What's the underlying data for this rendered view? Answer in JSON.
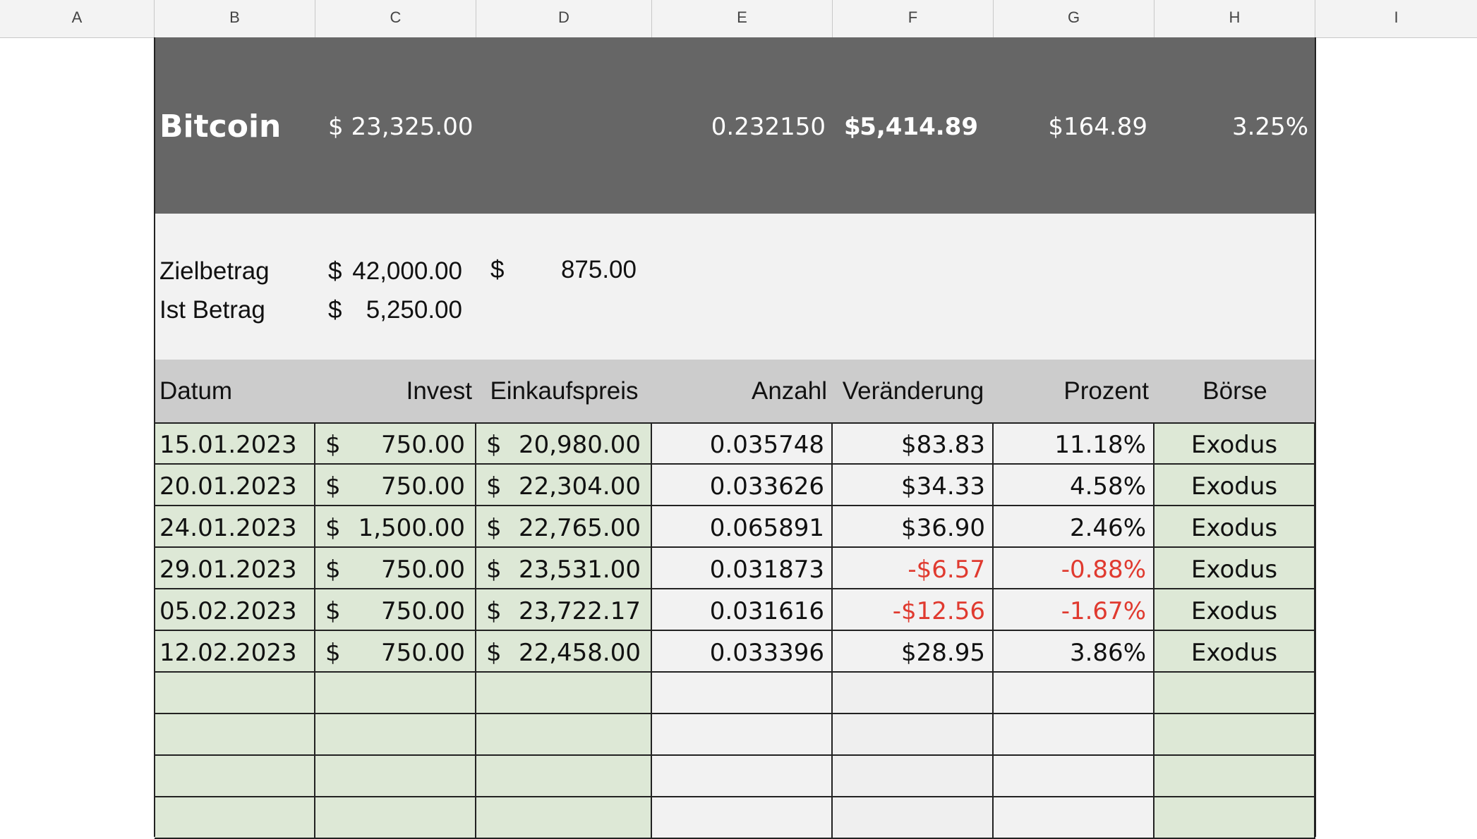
{
  "columns": [
    "A",
    "B",
    "C",
    "D",
    "E",
    "F",
    "G",
    "H",
    "I"
  ],
  "banner": {
    "name": "Bitcoin",
    "price": "$ 23,325.00",
    "quantity": "0.232150",
    "value_currency": "$",
    "value_amount": "5,414.89",
    "change": "$164.89",
    "percent": "3.25%"
  },
  "summary": {
    "target_label": "Zielbetrag",
    "target_currency": "$",
    "target_amount": "42,000.00",
    "extra_currency": "$",
    "extra_amount": "875.00",
    "actual_label": "Ist Betrag",
    "actual_currency": "$",
    "actual_amount": "5,250.00"
  },
  "table": {
    "headers": {
      "date": "Datum",
      "invest": "Invest",
      "price": "Einkaufspreis",
      "quantity": "Anzahl",
      "change": "Veränderung",
      "percent": "Prozent",
      "exchange": "Börse"
    },
    "rows": [
      {
        "date": "15.01.2023",
        "invest_ccy": "$",
        "invest": "750.00",
        "price_ccy": "$",
        "price": "20,980.00",
        "quantity": "0.035748",
        "change": "$83.83",
        "percent": "11.18%",
        "exchange": "Exodus"
      },
      {
        "date": "20.01.2023",
        "invest_ccy": "$",
        "invest": "750.00",
        "price_ccy": "$",
        "price": "22,304.00",
        "quantity": "0.033626",
        "change": "$34.33",
        "percent": "4.58%",
        "exchange": "Exodus"
      },
      {
        "date": "24.01.2023",
        "invest_ccy": "$",
        "invest": "1,500.00",
        "price_ccy": "$",
        "price": "22,765.00",
        "quantity": "0.065891",
        "change": "$36.90",
        "percent": "2.46%",
        "exchange": "Exodus"
      },
      {
        "date": "29.01.2023",
        "invest_ccy": "$",
        "invest": "750.00",
        "price_ccy": "$",
        "price": "23,531.00",
        "quantity": "0.031873",
        "change": "-$6.57",
        "percent": "-0.88%",
        "exchange": "Exodus"
      },
      {
        "date": "05.02.2023",
        "invest_ccy": "$",
        "invest": "750.00",
        "price_ccy": "$",
        "price": "23,722.17",
        "quantity": "0.031616",
        "change": "-$12.56",
        "percent": "-1.67%",
        "exchange": "Exodus"
      },
      {
        "date": "12.02.2023",
        "invest_ccy": "$",
        "invest": "750.00",
        "price_ccy": "$",
        "price": "22,458.00",
        "quantity": "0.033396",
        "change": "$28.95",
        "percent": "3.86%",
        "exchange": "Exodus"
      }
    ]
  },
  "colors": {
    "banner_bg": "#666666",
    "summary_bg": "#f2f2f2",
    "header_bg": "#cccccc",
    "input_green": "#dde8d6",
    "negative_red": "#e03a2f"
  }
}
